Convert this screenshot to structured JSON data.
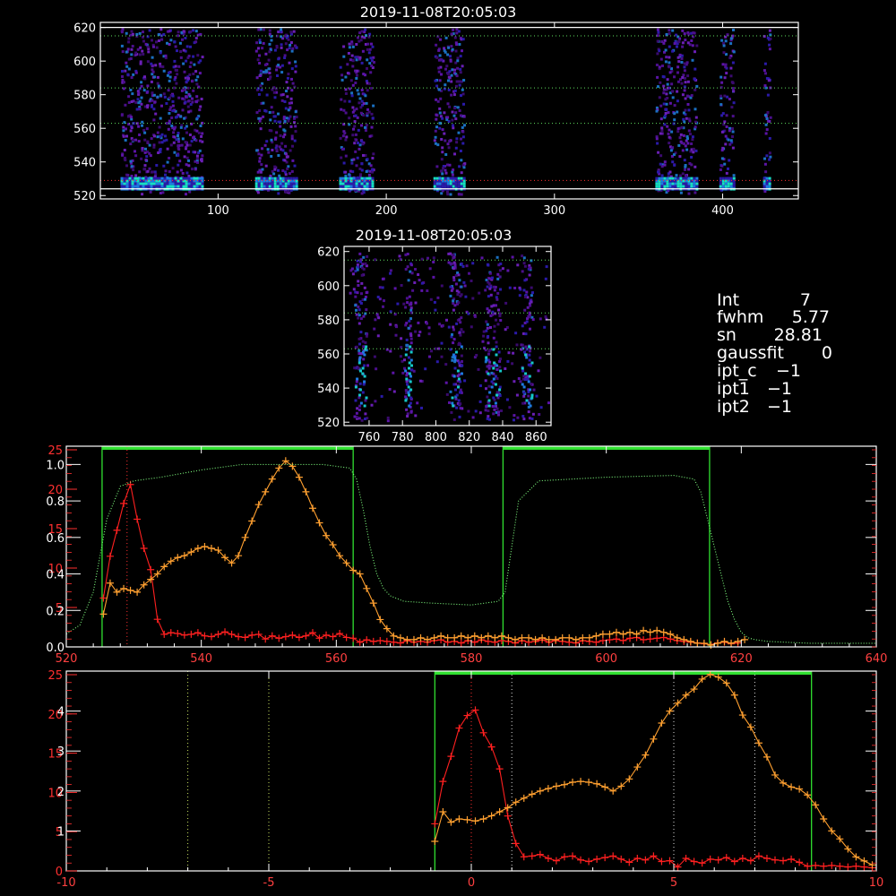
{
  "panels": {
    "top_image": {
      "title": "2019-11-08T20:05:03",
      "x_ticks": [
        100,
        200,
        300,
        400
      ],
      "y_ticks": [
        520,
        540,
        560,
        580,
        600,
        620
      ],
      "x_range": [
        30,
        445
      ],
      "y_range": [
        518,
        623
      ],
      "green_dotted_y": [
        615,
        584,
        563
      ],
      "white_lines_y": [
        620,
        524
      ],
      "red_dotted_y": [
        529
      ],
      "bright_columns": [
        {
          "x0": 42,
          "x1": 90
        },
        {
          "x0": 122,
          "x1": 146
        },
        {
          "x0": 172,
          "x1": 192
        },
        {
          "x0": 228,
          "x1": 246
        },
        {
          "x0": 360,
          "x1": 384
        },
        {
          "x0": 398,
          "x1": 406
        },
        {
          "x0": 424,
          "x1": 428
        }
      ]
    },
    "mid_image": {
      "title": "2019-11-08T20:05:03",
      "x_ticks": [
        760,
        780,
        800,
        820,
        840,
        860
      ],
      "y_ticks": [
        520,
        540,
        560,
        580,
        600,
        620
      ],
      "x_range": [
        745,
        869
      ],
      "y_range": [
        518,
        623
      ],
      "green_dotted_y": [
        615,
        584,
        563
      ],
      "bright_columns": [
        {
          "x0": 751,
          "x1": 758
        },
        {
          "x0": 781,
          "x1": 785
        },
        {
          "x0": 808,
          "x1": 815
        },
        {
          "x0": 829,
          "x1": 838
        },
        {
          "x0": 851,
          "x1": 857
        }
      ]
    },
    "info": {
      "lines": [
        {
          "label": "Int",
          "value": "7"
        },
        {
          "label": "fwhm",
          "value": "5.77"
        },
        {
          "label": "sn",
          "value": "28.81"
        },
        {
          "label": "gaussfit",
          "value": "0"
        },
        {
          "label": "ipt_c",
          "value": "−1"
        },
        {
          "label": "ipt1",
          "value": "−1"
        },
        {
          "label": "ipt2",
          "value": "−1"
        }
      ]
    }
  },
  "chart_data": [
    {
      "type": "line",
      "x_range": [
        520,
        640
      ],
      "x_ticks": [
        520,
        540,
        560,
        580,
        600,
        620,
        640
      ],
      "y_left_red_ticks": [
        5,
        10,
        15,
        20,
        25
      ],
      "y_left_red_range": [
        0,
        25
      ],
      "y_left_white_ticks": [
        "0.0",
        "0.2",
        "0.4",
        "0.6",
        "0.8",
        "1.0"
      ],
      "y_left_white_range": [
        0,
        1.1
      ],
      "green_windows": [
        [
          525.3,
          562.5
        ],
        [
          584.7,
          615.3
        ]
      ],
      "red_dotted_x": [
        529
      ],
      "series": [
        {
          "color": "#ff2020",
          "axis": "red",
          "x": [
            525.5,
            526.5,
            527.5,
            528.5,
            529.5,
            530.5,
            531.5,
            532.5,
            533.5,
            534.5,
            535.5,
            536.5,
            537.5,
            538.5,
            539.5,
            540.5,
            541.5,
            542.5,
            543.5,
            544.5,
            545.5,
            546.5,
            547.5,
            548.5,
            549.5,
            550.5,
            551.5,
            552.5,
            553.5,
            554.5,
            555.5,
            556.5,
            557.5,
            558.5,
            559.5,
            560.5,
            561.5,
            562.5,
            563.5,
            564.5,
            565.5,
            566.5,
            567.5,
            568.5,
            569.5,
            570.5,
            571.5,
            572.5,
            573.5,
            574.5,
            575.5,
            576.5,
            577.5,
            578.5,
            579.5,
            580.5,
            581.5,
            582.5,
            583.5,
            584.5,
            585.5,
            586.5,
            587.5,
            588.5,
            589.5,
            590.5,
            591.5,
            592.5,
            593.5,
            594.5,
            595.5,
            596.5,
            597.5,
            598.5,
            599.5,
            600.5,
            601.5,
            602.5,
            603.5,
            604.5,
            605.5,
            606.5,
            607.5,
            608.5,
            609.5,
            610.5,
            611.5,
            612.5,
            613.5,
            614.5,
            615.5,
            616.5,
            617.5,
            618.5,
            619.5
          ],
          "y": [
            6.2,
            11.5,
            14.8,
            18.2,
            20.6,
            16.2,
            12.5,
            9.8,
            3.5,
            1.6,
            1.8,
            1.7,
            1.5,
            1.6,
            1.8,
            1.4,
            1.3,
            1.6,
            1.9,
            1.6,
            1.3,
            1.2,
            1.5,
            1.6,
            1.0,
            1.4,
            1.1,
            1.3,
            1.5,
            1.2,
            1.4,
            1.8,
            1.1,
            1.5,
            1.3,
            1.7,
            1.2,
            1.1,
            0.6,
            0.9,
            0.7,
            0.8,
            0.7,
            0.6,
            0.5,
            0.8,
            0.6,
            0.7,
            0.6,
            0.8,
            0.9,
            0.6,
            0.7,
            0.5,
            0.8,
            0.6,
            0.9,
            0.7,
            0.6,
            0.8,
            0.7,
            0.5,
            0.8,
            0.6,
            0.7,
            0.9,
            0.6,
            0.8,
            0.7,
            0.6,
            0.5,
            0.8,
            0.7,
            0.6,
            0.8,
            0.9,
            1.0,
            0.8,
            1.1,
            1.2,
            0.9,
            1.0,
            1.1,
            1.2,
            1.0,
            0.8,
            0.7,
            0.6,
            0.5,
            0.4,
            0.3,
            0.5,
            0.6,
            0.4,
            0.5
          ]
        },
        {
          "color": "#ffa030",
          "axis": "white",
          "x": [
            525.5,
            526.5,
            527.5,
            528.5,
            529.5,
            530.5,
            531.5,
            532.5,
            533.5,
            534.5,
            535.5,
            536.5,
            537.5,
            538.5,
            539.5,
            540.5,
            541.5,
            542.5,
            543.5,
            544.5,
            545.5,
            546.5,
            547.5,
            548.5,
            549.5,
            550.5,
            551.5,
            552.5,
            553.5,
            554.5,
            555.5,
            556.5,
            557.5,
            558.5,
            559.5,
            560.5,
            561.5,
            562.5,
            563.5,
            564.5,
            565.5,
            566.5,
            567.5,
            568.5,
            569.5,
            570.5,
            571.5,
            572.5,
            573.5,
            574.5,
            575.5,
            576.5,
            577.5,
            578.5,
            579.5,
            580.5,
            581.5,
            582.5,
            583.5,
            584.5,
            585.5,
            586.5,
            587.5,
            588.5,
            589.5,
            590.5,
            591.5,
            592.5,
            593.5,
            594.5,
            595.5,
            596.5,
            597.5,
            598.5,
            599.5,
            600.5,
            601.5,
            602.5,
            603.5,
            604.5,
            605.5,
            606.5,
            607.5,
            608.5,
            609.5,
            610.5,
            611.5,
            612.5,
            613.5,
            614.5,
            615.5,
            616.5,
            617.5,
            618.5,
            619.5,
            620.5
          ],
          "y": [
            0.18,
            0.35,
            0.3,
            0.32,
            0.31,
            0.3,
            0.34,
            0.37,
            0.4,
            0.44,
            0.47,
            0.49,
            0.5,
            0.52,
            0.54,
            0.55,
            0.54,
            0.53,
            0.49,
            0.46,
            0.5,
            0.6,
            0.69,
            0.78,
            0.85,
            0.92,
            0.98,
            1.02,
            0.99,
            0.93,
            0.85,
            0.76,
            0.68,
            0.61,
            0.56,
            0.5,
            0.46,
            0.42,
            0.4,
            0.32,
            0.24,
            0.15,
            0.1,
            0.06,
            0.05,
            0.04,
            0.04,
            0.05,
            0.04,
            0.05,
            0.06,
            0.05,
            0.05,
            0.06,
            0.05,
            0.06,
            0.05,
            0.06,
            0.05,
            0.06,
            0.05,
            0.04,
            0.05,
            0.05,
            0.04,
            0.05,
            0.04,
            0.04,
            0.05,
            0.05,
            0.04,
            0.05,
            0.05,
            0.06,
            0.07,
            0.07,
            0.08,
            0.07,
            0.08,
            0.07,
            0.09,
            0.08,
            0.09,
            0.08,
            0.07,
            0.05,
            0.04,
            0.03,
            0.02,
            0.02,
            0.01,
            0.02,
            0.03,
            0.02,
            0.03,
            0.04
          ]
        },
        {
          "color": "#80ff80",
          "axis": "white",
          "style": "dotted",
          "x": [
            520,
            522,
            524,
            526,
            528,
            530,
            534,
            540,
            546,
            552,
            558,
            562,
            563,
            564,
            565,
            566,
            567,
            568,
            570,
            574,
            580,
            584,
            585,
            586,
            587,
            590,
            600,
            610,
            613,
            614,
            615,
            616,
            617,
            618,
            619,
            620,
            621,
            622,
            624,
            630,
            640
          ],
          "y": [
            0.07,
            0.12,
            0.3,
            0.7,
            0.88,
            0.91,
            0.93,
            0.97,
            1.0,
            1.0,
            1.0,
            0.98,
            0.92,
            0.75,
            0.55,
            0.4,
            0.32,
            0.28,
            0.25,
            0.24,
            0.23,
            0.25,
            0.3,
            0.55,
            0.8,
            0.91,
            0.93,
            0.94,
            0.92,
            0.85,
            0.7,
            0.55,
            0.4,
            0.25,
            0.15,
            0.08,
            0.05,
            0.04,
            0.03,
            0.02,
            0.02
          ]
        }
      ]
    },
    {
      "type": "line",
      "x_range": [
        -10,
        10
      ],
      "x_ticks": [
        -10,
        -5,
        0,
        5,
        10
      ],
      "y_left_red_ticks": [
        0,
        5,
        10,
        15,
        20,
        25
      ],
      "y_left_red_range": [
        0,
        25
      ],
      "y_left_white_ticks": [
        1,
        2,
        3,
        4
      ],
      "y_left_white_range": [
        0,
        5.0
      ],
      "green_window": [
        -0.9,
        8.4
      ],
      "white_dotted_x": [
        -7,
        -5,
        1,
        5,
        7
      ],
      "red_dotted_x": [
        0
      ],
      "series": [
        {
          "color": "#ff2020",
          "axis": "red",
          "x": [
            -0.9,
            -0.7,
            -0.5,
            -0.3,
            -0.1,
            0.1,
            0.3,
            0.5,
            0.7,
            0.9,
            1.1,
            1.3,
            1.5,
            1.7,
            1.9,
            2.1,
            2.3,
            2.5,
            2.7,
            2.9,
            3.1,
            3.3,
            3.5,
            3.7,
            3.9,
            4.1,
            4.3,
            4.5,
            4.7,
            4.9,
            5.1,
            5.3,
            5.5,
            5.7,
            5.9,
            6.1,
            6.3,
            6.5,
            6.7,
            6.9,
            7.1,
            7.3,
            7.5,
            7.7,
            7.9,
            8.1,
            8.3,
            8.5,
            8.7,
            8.9,
            9.1,
            9.3,
            9.5,
            9.7,
            9.9
          ],
          "y": [
            6.0,
            11.4,
            14.6,
            18.2,
            19.8,
            20.5,
            17.6,
            15.8,
            13.0,
            7.0,
            3.5,
            1.8,
            1.9,
            2.1,
            1.6,
            1.3,
            1.8,
            1.9,
            1.4,
            1.2,
            1.5,
            1.7,
            1.9,
            1.5,
            1.1,
            1.6,
            1.4,
            1.9,
            1.2,
            1.3,
            0.5,
            1.6,
            1.2,
            1.0,
            1.5,
            1.4,
            1.7,
            1.2,
            1.6,
            1.3,
            1.9,
            1.6,
            1.4,
            1.3,
            1.5,
            1.1,
            0.6,
            0.7,
            0.6,
            0.7,
            0.6,
            0.5,
            0.6,
            0.5,
            0.4
          ]
        },
        {
          "color": "#ffa030",
          "axis": "white",
          "x": [
            -0.9,
            -0.7,
            -0.5,
            -0.3,
            -0.1,
            0.1,
            0.3,
            0.5,
            0.7,
            0.9,
            1.1,
            1.3,
            1.5,
            1.7,
            1.9,
            2.1,
            2.3,
            2.5,
            2.7,
            2.9,
            3.1,
            3.3,
            3.5,
            3.7,
            3.9,
            4.1,
            4.3,
            4.5,
            4.7,
            4.9,
            5.1,
            5.3,
            5.5,
            5.7,
            5.9,
            6.1,
            6.3,
            6.5,
            6.7,
            6.9,
            7.1,
            7.3,
            7.5,
            7.7,
            7.9,
            8.1,
            8.3,
            8.5,
            8.7,
            8.9,
            9.1,
            9.3,
            9.5,
            9.7,
            9.9
          ],
          "y": [
            0.74,
            1.48,
            1.22,
            1.3,
            1.28,
            1.25,
            1.3,
            1.38,
            1.48,
            1.58,
            1.72,
            1.82,
            1.92,
            2.0,
            2.06,
            2.12,
            2.16,
            2.22,
            2.24,
            2.22,
            2.18,
            2.1,
            2.0,
            2.12,
            2.3,
            2.6,
            2.9,
            3.3,
            3.7,
            4.0,
            4.2,
            4.4,
            4.55,
            4.8,
            4.92,
            4.85,
            4.7,
            4.4,
            3.9,
            3.6,
            3.2,
            2.85,
            2.4,
            2.2,
            2.1,
            2.05,
            1.9,
            1.65,
            1.3,
            1.0,
            0.8,
            0.55,
            0.35,
            0.25,
            0.15
          ]
        }
      ]
    }
  ]
}
